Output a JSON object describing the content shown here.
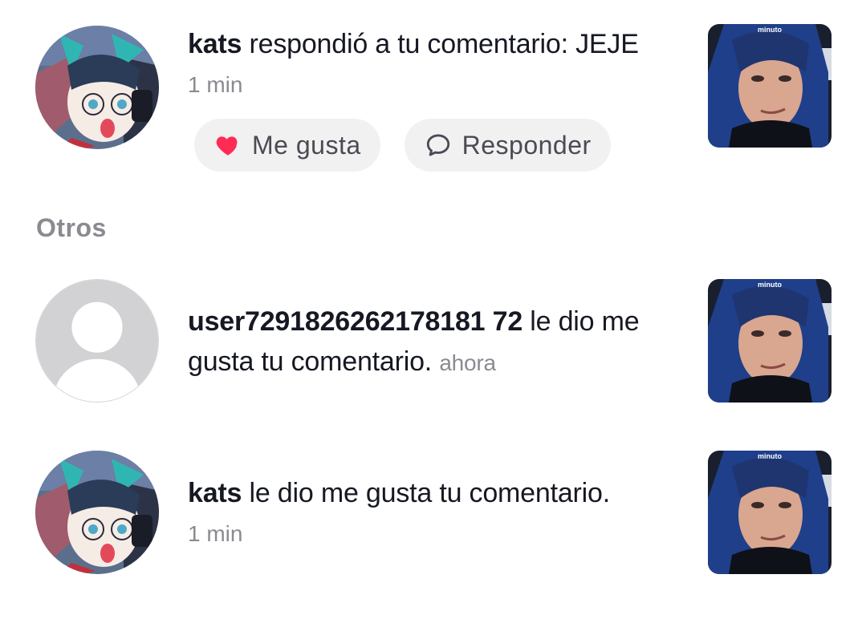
{
  "notifications": [
    {
      "username": "kats",
      "message": " respondió a tu comentario: JEJE",
      "time": "1 min",
      "thumbnail_label": "minuto",
      "actions": {
        "like_label": "Me gusta",
        "reply_label": "Responder"
      }
    },
    {
      "username": "user7291826262178181 72",
      "message": " le dio me gusta tu comentario.",
      "time": "ahora",
      "thumbnail_label": "minuto"
    },
    {
      "username": "kats",
      "message": " le dio me gusta tu comentario.",
      "time": "1 min",
      "thumbnail_label": "minuto"
    }
  ],
  "section": {
    "title": "Otros"
  },
  "icons": {
    "like": "heart-icon",
    "reply": "speech-bubble-icon",
    "default_avatar": "default-user-avatar"
  },
  "colors": {
    "heart": "#fe2c55",
    "pill_bg": "#f1f1f2",
    "muted_text": "#8a8b91",
    "primary_text": "#161823"
  }
}
